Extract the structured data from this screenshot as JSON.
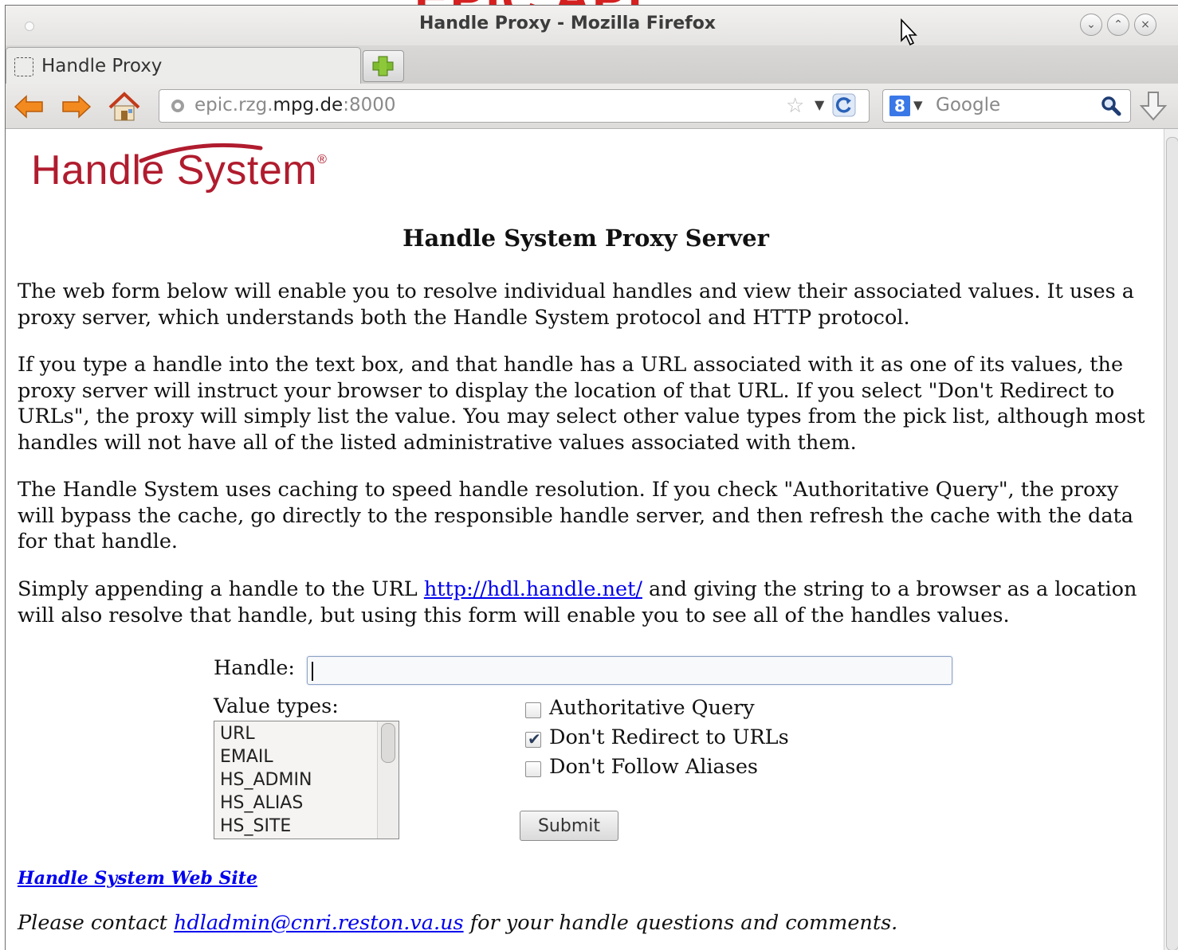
{
  "banner": {
    "text": "EPIC API"
  },
  "window": {
    "title": "Handle Proxy - Mozilla Firefox",
    "controls": {
      "minimize": "⌄",
      "maximize": "⌃",
      "close": "×"
    }
  },
  "tabs": [
    {
      "label": "Handle Proxy"
    }
  ],
  "navbar": {
    "url_prefix": "epic.rzg.",
    "url_domain": "mpg.de",
    "url_suffix": ":8000",
    "search_engine_label": "8",
    "search_placeholder": "Google"
  },
  "page": {
    "logo_text": "Handle System",
    "logo_mark": "®",
    "title": "Handle System Proxy Server",
    "paragraphs": {
      "p1": "The web form below will enable you to resolve individual handles and view their associated values. It uses a proxy server, which understands both the Handle System protocol and HTTP protocol.",
      "p2": "If you type a handle into the text box, and that handle has a URL associated with it as one of its values, the proxy server will instruct your browser to display the location of that URL.  If you select \"Don't Redirect to URLs\", the proxy will simply list the value. You may select other value types from the pick list, although most handles will not have all of the listed administrative values associated with them.",
      "p3": "The Handle System uses caching to speed handle resolution. If you check \"Authoritative Query\", the proxy will bypass the cache, go directly to the responsible handle server, and then refresh the cache with the data for that handle.",
      "p4_before": "Simply appending a handle to the URL ",
      "p4_link": "http://hdl.handle.net/",
      "p4_after": " and giving the string to a browser as a location will also resolve that handle, but using this form will enable  you to see all of the handles values."
    },
    "form": {
      "handle_label": "Handle:",
      "handle_value": "",
      "value_types_label": "Value types:",
      "value_types": [
        "URL",
        "EMAIL",
        "HS_ADMIN",
        "HS_ALIAS",
        "HS_SITE"
      ],
      "checkboxes": [
        {
          "label": "Authoritative Query",
          "checked": false
        },
        {
          "label": "Don't Redirect to URLs",
          "checked": true
        },
        {
          "label": "Don't Follow Aliases",
          "checked": false
        }
      ],
      "submit_label": "Submit"
    },
    "footer": {
      "site_link": "Handle System Web Site",
      "contact_before": "Please contact ",
      "contact_email": "hdladmin@cnri.reston.va.us",
      "contact_after": " for your handle questions and comments."
    }
  }
}
